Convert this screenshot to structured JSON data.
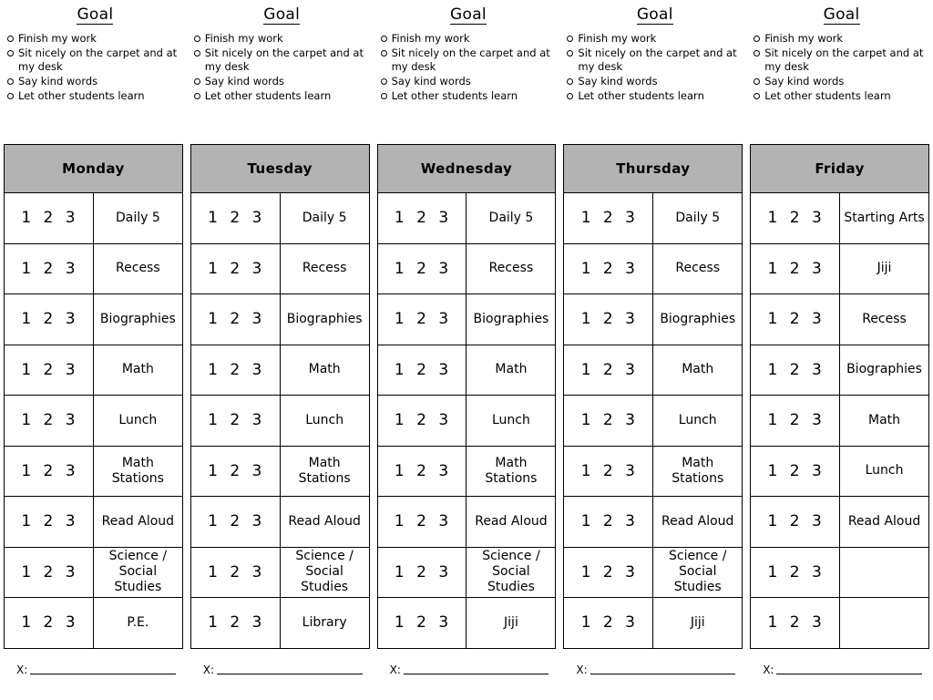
{
  "goal": {
    "title": "Goal",
    "items": [
      "Finish my work",
      "Sit nicely on the carpet and at my desk",
      "Say kind words",
      "Let other students learn"
    ]
  },
  "signature": {
    "label": "X:"
  },
  "rating_scale": "1 2 3",
  "colors": {
    "header_gray": "#b3b3b3",
    "border": "#000000",
    "page_background": "#ffffff"
  },
  "days": [
    {
      "name": "Monday",
      "rows": [
        {
          "rating": "1 2 3",
          "activity": "Daily 5"
        },
        {
          "rating": "1 2 3",
          "activity": "Recess"
        },
        {
          "rating": "1 2 3",
          "activity": "Biographies"
        },
        {
          "rating": "1 2 3",
          "activity": "Math"
        },
        {
          "rating": "1 2 3",
          "activity": "Lunch"
        },
        {
          "rating": "1 2 3",
          "activity": "Math Stations"
        },
        {
          "rating": "1 2 3",
          "activity": "Read Aloud"
        },
        {
          "rating": "1 2 3",
          "activity": "Science /\nSocial Studies"
        },
        {
          "rating": "1 2 3",
          "activity": "P.E."
        }
      ]
    },
    {
      "name": "Tuesday",
      "rows": [
        {
          "rating": "1 2 3",
          "activity": "Daily 5"
        },
        {
          "rating": "1 2 3",
          "activity": "Recess"
        },
        {
          "rating": "1 2 3",
          "activity": "Biographies"
        },
        {
          "rating": "1 2 3",
          "activity": "Math"
        },
        {
          "rating": "1 2 3",
          "activity": "Lunch"
        },
        {
          "rating": "1 2 3",
          "activity": "Math Stations"
        },
        {
          "rating": "1 2 3",
          "activity": "Read Aloud"
        },
        {
          "rating": "1 2 3",
          "activity": "Science /\nSocial Studies"
        },
        {
          "rating": "1 2 3",
          "activity": "Library"
        }
      ]
    },
    {
      "name": "Wednesday",
      "rows": [
        {
          "rating": "1 2 3",
          "activity": "Daily 5"
        },
        {
          "rating": "1 2 3",
          "activity": "Recess"
        },
        {
          "rating": "1 2 3",
          "activity": "Biographies"
        },
        {
          "rating": "1 2 3",
          "activity": "Math"
        },
        {
          "rating": "1 2 3",
          "activity": "Lunch"
        },
        {
          "rating": "1 2 3",
          "activity": "Math Stations"
        },
        {
          "rating": "1 2 3",
          "activity": "Read Aloud"
        },
        {
          "rating": "1 2 3",
          "activity": "Science /\nSocial Studies"
        },
        {
          "rating": "1 2 3",
          "activity": "Jiji"
        }
      ]
    },
    {
      "name": "Thursday",
      "rows": [
        {
          "rating": "1 2 3",
          "activity": "Daily 5"
        },
        {
          "rating": "1 2 3",
          "activity": "Recess"
        },
        {
          "rating": "1 2 3",
          "activity": "Biographies"
        },
        {
          "rating": "1 2 3",
          "activity": "Math"
        },
        {
          "rating": "1 2 3",
          "activity": "Lunch"
        },
        {
          "rating": "1 2 3",
          "activity": "Math Stations"
        },
        {
          "rating": "1 2 3",
          "activity": "Read Aloud"
        },
        {
          "rating": "1 2 3",
          "activity": "Science /\nSocial Studies"
        },
        {
          "rating": "1 2 3",
          "activity": "Jiji"
        }
      ]
    },
    {
      "name": "Friday",
      "rows": [
        {
          "rating": "1 2 3",
          "activity": "Starting Arts"
        },
        {
          "rating": "1 2 3",
          "activity": "Jiji"
        },
        {
          "rating": "1 2 3",
          "activity": "Recess"
        },
        {
          "rating": "1 2 3",
          "activity": "Biographies"
        },
        {
          "rating": "1 2 3",
          "activity": "Math"
        },
        {
          "rating": "1 2 3",
          "activity": "Lunch"
        },
        {
          "rating": "1 2 3",
          "activity": "Read Aloud"
        },
        {
          "rating": "1 2 3",
          "activity": ""
        },
        {
          "rating": "1 2 3",
          "activity": ""
        }
      ]
    }
  ]
}
